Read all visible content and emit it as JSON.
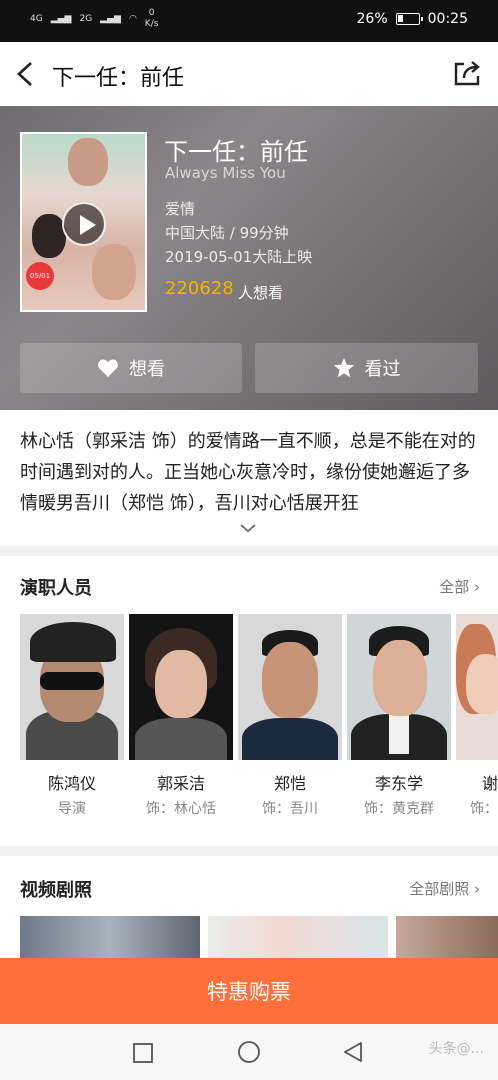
{
  "status_bar": {
    "signal1": "4G",
    "signal2": "2G",
    "speed_value": "0",
    "speed_unit": "K/s",
    "battery": "26%",
    "time": "00:25",
    "battery_level": 0.26
  },
  "nav": {
    "title": "下一任：前任"
  },
  "movie": {
    "title": "下一任：前任",
    "english_title": "Always Miss You",
    "genre": "爱情",
    "region_duration": "中国大陆 / 99分钟",
    "release": "2019-05-01大陆上映",
    "want_count": "220628",
    "want_label": "人想看",
    "poster_badge": "05/01"
  },
  "actions": {
    "want": "想看",
    "seen": "看过"
  },
  "synopsis": "林心恬（郭采洁 饰）的爱情路一直不顺，总是不能在对的时间遇到对的人。正当她心灰意冷时，缘份使她邂逅了多情暖男吾川（郑恺 饰），吾川对心恬展开狂",
  "cast_section": {
    "title": "演职人员",
    "more": "全部",
    "members": [
      {
        "name": "陈鸿仪",
        "role": "导演"
      },
      {
        "name": "郭采洁",
        "role": "饰：林心恬"
      },
      {
        "name": "郑恺",
        "role": "饰：吾川"
      },
      {
        "name": "李东学",
        "role": "饰：黄克群"
      },
      {
        "name": "谢",
        "role": "饰："
      }
    ]
  },
  "video_section": {
    "title": "视频剧照",
    "more": "全部剧照"
  },
  "buy": {
    "label": "特惠购票"
  },
  "watermark": {
    "text": "头条@..."
  },
  "colors": {
    "accent": "#ff6f3b",
    "want_count": "#f6b400"
  }
}
